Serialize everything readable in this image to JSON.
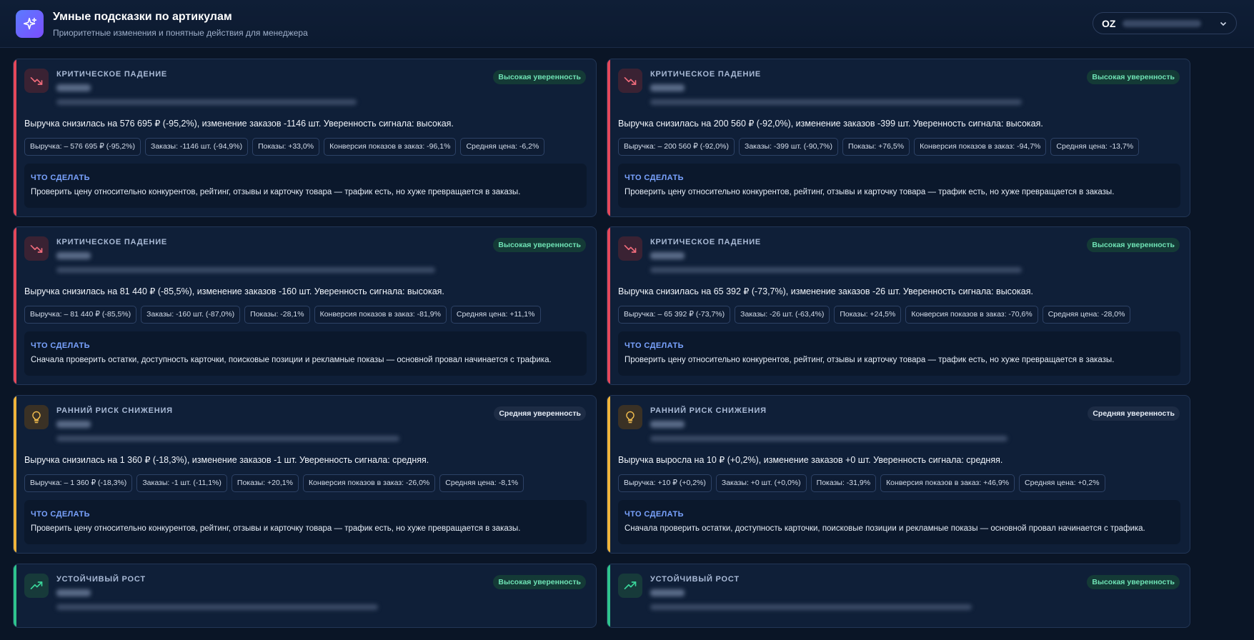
{
  "header": {
    "title": "Умные подсказки по артикулам",
    "subtitle": "Приоритетные изменения и понятные действия для менеджера",
    "account_code": "OZ"
  },
  "colors": {
    "critical": "#e5485a",
    "early_risk": "#f0b43a",
    "growth": "#2ec48d",
    "action_title": "#7aa3ff"
  },
  "cards": [
    {
      "type": "critical",
      "icon": "trend-down-icon",
      "category": "КРИТИЧЕСКОЕ ПАДЕНИЕ",
      "confidence": "Высокая уверенность",
      "summary": "Выручка снизилась на 576 695 ₽ (-95,2%), изменение заказов -1146 шт. Уверенность сигнала: высокая.",
      "chips": [
        "Выручка: – 576 695 ₽ (-95,2%)",
        "Заказы: -1146 шт. (-94,9%)",
        "Показы: +33,0%",
        "Конверсия показов в заказ: -96,1%",
        "Средняя цена: -6,2%"
      ],
      "action_title": "ЧТО СДЕЛАТЬ",
      "action_text": "Проверить цену относительно конкурентов, рейтинг, отзывы и карточку товара — трафик есть, но хуже превращается в заказы."
    },
    {
      "type": "critical",
      "icon": "trend-down-icon",
      "category": "КРИТИЧЕСКОЕ ПАДЕНИЕ",
      "confidence": "Высокая уверенность",
      "summary": "Выручка снизилась на 200 560 ₽ (-92,0%), изменение заказов -399 шт. Уверенность сигнала: высокая.",
      "chips": [
        "Выручка: – 200 560 ₽ (-92,0%)",
        "Заказы: -399 шт. (-90,7%)",
        "Показы: +76,5%",
        "Конверсия показов в заказ: -94,7%",
        "Средняя цена: -13,7%"
      ],
      "action_title": "ЧТО СДЕЛАТЬ",
      "action_text": "Проверить цену относительно конкурентов, рейтинг, отзывы и карточку товара — трафик есть, но хуже превращается в заказы."
    },
    {
      "type": "critical",
      "icon": "trend-down-icon",
      "category": "КРИТИЧЕСКОЕ ПАДЕНИЕ",
      "confidence": "Высокая уверенность",
      "summary": "Выручка снизилась на 81 440 ₽ (-85,5%), изменение заказов -160 шт. Уверенность сигнала: высокая.",
      "chips": [
        "Выручка: – 81 440 ₽ (-85,5%)",
        "Заказы: -160 шт. (-87,0%)",
        "Показы: -28,1%",
        "Конверсия показов в заказ: -81,9%",
        "Средняя цена: +11,1%"
      ],
      "action_title": "ЧТО СДЕЛАТЬ",
      "action_text": "Сначала проверить остатки, доступность карточки, поисковые позиции и рекламные показы — основной провал начинается с трафика."
    },
    {
      "type": "critical",
      "icon": "trend-down-icon",
      "category": "КРИТИЧЕСКОЕ ПАДЕНИЕ",
      "confidence": "Высокая уверенность",
      "summary": "Выручка снизилась на 65 392 ₽ (-73,7%), изменение заказов -26 шт. Уверенность сигнала: высокая.",
      "chips": [
        "Выручка: – 65 392 ₽ (-73,7%)",
        "Заказы: -26 шт. (-63,4%)",
        "Показы: +24,5%",
        "Конверсия показов в заказ: -70,6%",
        "Средняя цена: -28,0%"
      ],
      "action_title": "ЧТО СДЕЛАТЬ",
      "action_text": "Проверить цену относительно конкурентов, рейтинг, отзывы и карточку товара — трафик есть, но хуже превращается в заказы."
    },
    {
      "type": "early-risk",
      "icon": "lightbulb-icon",
      "category": "РАННИЙ РИСК СНИЖЕНИЯ",
      "confidence": "Средняя уверенность",
      "summary": "Выручка снизилась на 1 360 ₽ (-18,3%), изменение заказов -1 шт. Уверенность сигнала: средняя.",
      "chips": [
        "Выручка: – 1 360 ₽ (-18,3%)",
        "Заказы: -1 шт. (-11,1%)",
        "Показы: +20,1%",
        "Конверсия показов в заказ: -26,0%",
        "Средняя цена: -8,1%"
      ],
      "action_title": "ЧТО СДЕЛАТЬ",
      "action_text": "Проверить цену относительно конкурентов, рейтинг, отзывы и карточку товара — трафик есть, но хуже превращается в заказы."
    },
    {
      "type": "early-risk",
      "icon": "lightbulb-icon",
      "category": "РАННИЙ РИСК СНИЖЕНИЯ",
      "confidence": "Средняя уверенность",
      "summary": "Выручка выросла на 10 ₽ (+0,2%), изменение заказов +0 шт. Уверенность сигнала: средняя.",
      "chips": [
        "Выручка: +10 ₽ (+0,2%)",
        "Заказы: +0 шт. (+0,0%)",
        "Показы: -31,9%",
        "Конверсия показов в заказ: +46,9%",
        "Средняя цена: +0,2%"
      ],
      "action_title": "ЧТО СДЕЛАТЬ",
      "action_text": "Сначала проверить остатки, доступность карточки, поисковые позиции и рекламные показы — основной провал начинается с трафика."
    },
    {
      "type": "growth",
      "icon": "trend-up-icon",
      "category": "УСТОЙЧИВЫЙ РОСТ",
      "confidence": "Высокая уверенность"
    },
    {
      "type": "growth",
      "icon": "trend-up-icon",
      "category": "УСТОЙЧИВЫЙ РОСТ",
      "confidence": "Высокая уверенность"
    }
  ]
}
